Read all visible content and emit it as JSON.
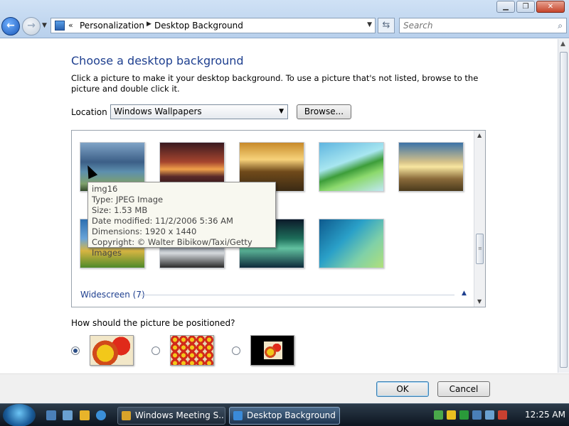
{
  "nav": {
    "breadcrumb": [
      "Personalization",
      "Desktop Background"
    ],
    "search_placeholder": "Search"
  },
  "window_buttons": [
    "minimize",
    "maximize",
    "close"
  ],
  "main": {
    "heading": "Choose a desktop background",
    "description": "Click a picture to make it your desktop background. To use a picture that's not listed, browse to the picture and double click it.",
    "location_label": "Location",
    "location_value": "Windows Wallpapers",
    "browse_label": "Browse...",
    "section_header": "Widescreen (7)",
    "tooltip": {
      "name": "img16",
      "type": "Type: JPEG Image",
      "size": "Size: 1.53 MB",
      "date": "Date modified: 11/2/2006 5:36 AM",
      "dimensions": "Dimensions: 1920 x 1440",
      "copyright": "Copyright: © Walter Bibikow/Taxi/Getty Images"
    },
    "position_question": "How should the picture be positioned?",
    "position_options": [
      {
        "name": "fit-to-screen",
        "selected": true
      },
      {
        "name": "tile",
        "selected": false
      },
      {
        "name": "center",
        "selected": false
      }
    ]
  },
  "footer": {
    "ok_label": "OK",
    "cancel_label": "Cancel"
  },
  "taskbar": {
    "tasks": [
      "Windows Meeting S...",
      "Desktop Background"
    ],
    "clock": "12:25 AM"
  },
  "colors": {
    "heading": "#1e3f8f",
    "taskbar": "#1a2430"
  }
}
